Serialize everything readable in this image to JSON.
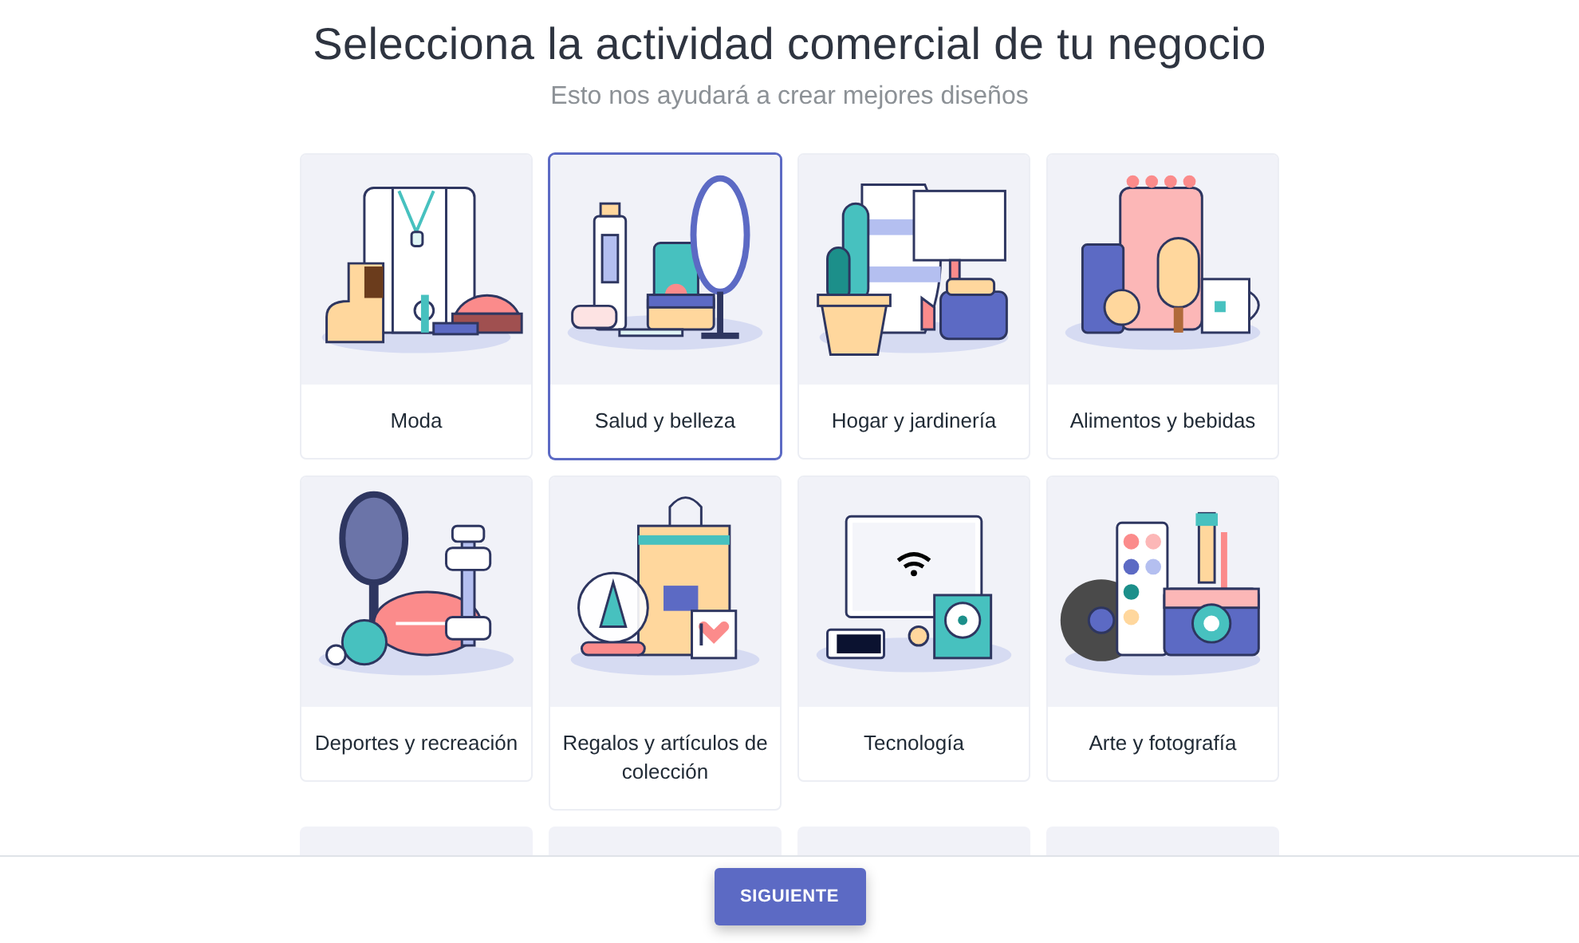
{
  "header": {
    "title": "Selecciona la actividad comercial de tu negocio",
    "subtitle": "Esto nos ayudará a crear mejores diseños"
  },
  "categories": [
    {
      "label": "Moda",
      "selected": false
    },
    {
      "label": "Salud y belleza",
      "selected": true
    },
    {
      "label": "Hogar y jardinería",
      "selected": false
    },
    {
      "label": "Alimentos y bebidas",
      "selected": false
    },
    {
      "label": "Deportes y recreación",
      "selected": false
    },
    {
      "label": "Regalos y artículos de colección",
      "selected": false
    },
    {
      "label": "Tecnología",
      "selected": false
    },
    {
      "label": "Arte y fotografía",
      "selected": false
    }
  ],
  "footer": {
    "button": "SIGUIENTE"
  }
}
